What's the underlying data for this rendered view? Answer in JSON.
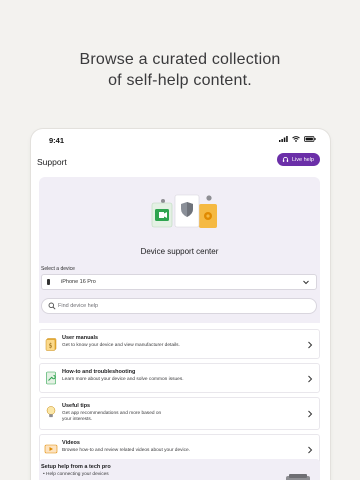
{
  "headline": {
    "line1": "Browse a curated collection",
    "line2": "of self-help content."
  },
  "status_bar": {
    "time": "9:41"
  },
  "app_bar": {
    "title": "Support",
    "live_help_label": "Live help"
  },
  "hero": {
    "title": "Device support center",
    "select_label": "Select a device",
    "selected_device": "iPhone 16 Pro",
    "search_placeholder": "Find device help"
  },
  "list": [
    {
      "title": "User manuals",
      "description": "Get to know your device and view manufacturer details.",
      "icon": "book-icon"
    },
    {
      "title": "How-to and troubleshooting",
      "description": "Learn more about your device and solve common issues.",
      "icon": "wrench-document-icon"
    },
    {
      "title": "Useful tips",
      "description": "Get app recommendations and more based on your interests.",
      "icon": "lightbulb-icon"
    },
    {
      "title": "Videos",
      "description": "Browse how-to and review related videos about your device.",
      "icon": "video-icon"
    }
  ],
  "setup": {
    "title": "Setup help from a tech pro",
    "item": "• Help connecting your devices"
  },
  "colors": {
    "accent": "#6b2fa8",
    "hero_bg": "#f1eef6",
    "page_bg": "#f3f2ef"
  }
}
